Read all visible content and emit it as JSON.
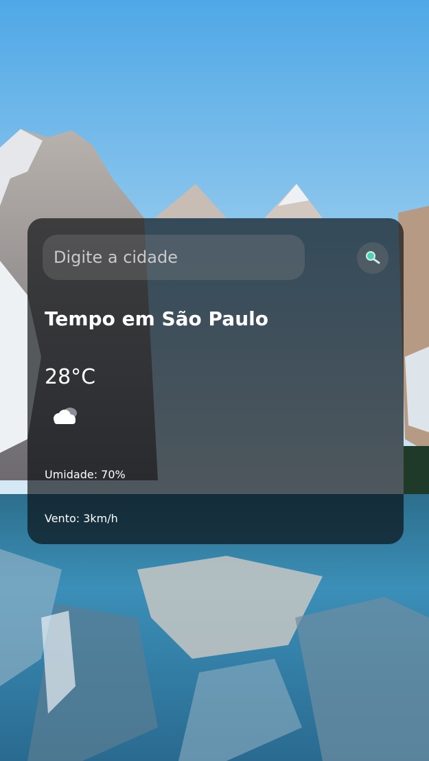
{
  "search": {
    "placeholder": "Digite a cidade",
    "button_icon": "search-icon"
  },
  "weather": {
    "title": "Tempo em São Paulo",
    "temperature": "28°C",
    "condition_icon": "partly-cloudy-icon",
    "humidity": "Umidade: 70%",
    "wind": "Vento: 3km/h"
  },
  "colors": {
    "card_background": "#080a0e",
    "text": "#ffffff",
    "placeholder": "#c9c9c9",
    "sky_top": "#5fb1e8",
    "sky_bottom": "#cfe6f4",
    "lake": "#2f7fa8"
  }
}
